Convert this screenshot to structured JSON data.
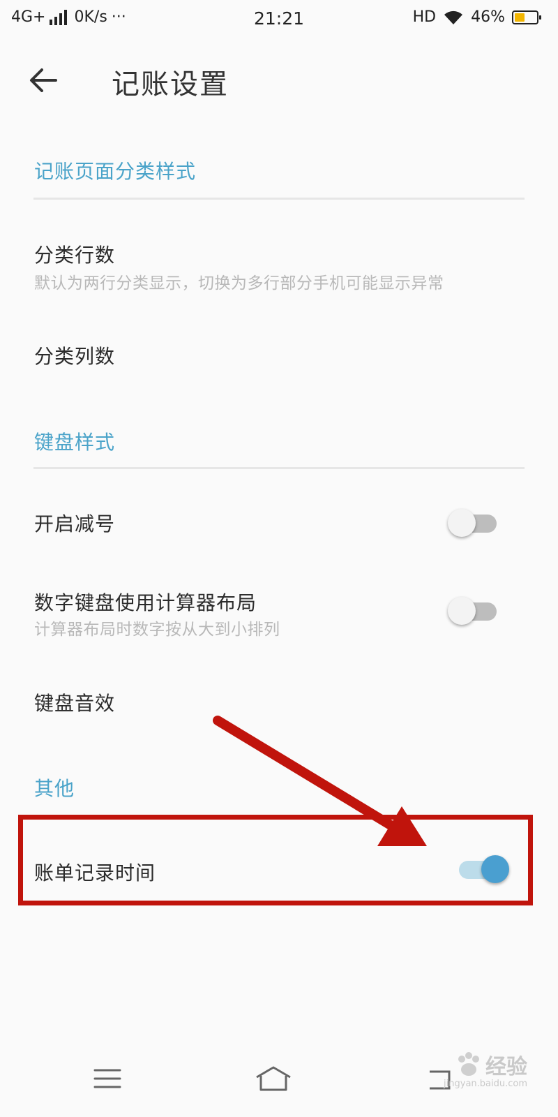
{
  "status_bar": {
    "network": "4G+",
    "speed": "0K/s",
    "more": "···",
    "time": "21:21",
    "hd": "HD",
    "battery_percent": "46%",
    "battery_level": 0.46,
    "battery_color": "#f2b500"
  },
  "header": {
    "back_icon": "arrow-left-icon",
    "title": "记账设置"
  },
  "sections": {
    "category_style": {
      "header": "记账页面分类样式",
      "rows": {
        "rows_count": {
          "title": "分类行数",
          "subtitle": "默认为两行分类显示，切换为多行部分手机可能显示异常"
        },
        "cols_count": {
          "title": "分类列数"
        }
      }
    },
    "keyboard": {
      "header": "键盘样式",
      "rows": {
        "minus": {
          "title": "开启减号",
          "toggle": "off"
        },
        "calculator": {
          "title": "数字键盘使用计算器布局",
          "subtitle": "计算器布局时数字按从大到小排列",
          "toggle": "off"
        },
        "sound": {
          "title": "键盘音效"
        }
      }
    },
    "other": {
      "header": "其他",
      "rows": {
        "record_time": {
          "title": "账单记录时间",
          "toggle": "on"
        }
      }
    }
  },
  "colors": {
    "accent": "#4aa3c9",
    "annotation": "#c0140c",
    "switch_on": "#4a9fd0"
  },
  "nav_bar": {
    "menu_icon": "menu-icon",
    "home_icon": "home-icon",
    "back_icon": "back-icon"
  },
  "watermark": {
    "text": "经验",
    "url": "jingyan.baidu.com"
  }
}
